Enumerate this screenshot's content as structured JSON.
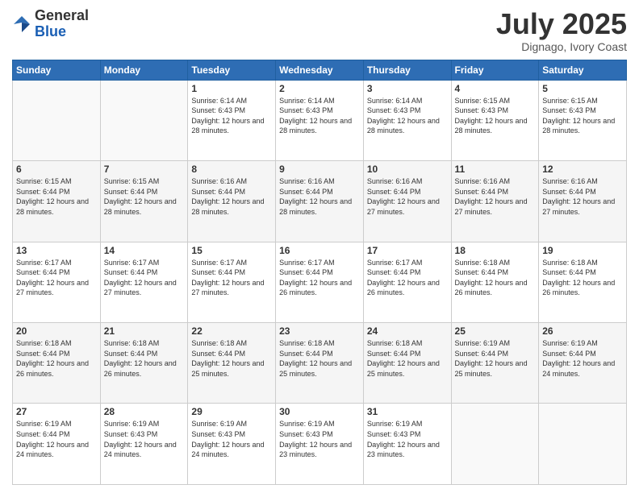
{
  "logo": {
    "general": "General",
    "blue": "Blue"
  },
  "header": {
    "month": "July 2025",
    "location": "Dignago, Ivory Coast"
  },
  "weekdays": [
    "Sunday",
    "Monday",
    "Tuesday",
    "Wednesday",
    "Thursday",
    "Friday",
    "Saturday"
  ],
  "weeks": [
    [
      {
        "day": "",
        "sunrise": "",
        "sunset": "",
        "daylight": ""
      },
      {
        "day": "",
        "sunrise": "",
        "sunset": "",
        "daylight": ""
      },
      {
        "day": "1",
        "sunrise": "Sunrise: 6:14 AM",
        "sunset": "Sunset: 6:43 PM",
        "daylight": "Daylight: 12 hours and 28 minutes."
      },
      {
        "day": "2",
        "sunrise": "Sunrise: 6:14 AM",
        "sunset": "Sunset: 6:43 PM",
        "daylight": "Daylight: 12 hours and 28 minutes."
      },
      {
        "day": "3",
        "sunrise": "Sunrise: 6:14 AM",
        "sunset": "Sunset: 6:43 PM",
        "daylight": "Daylight: 12 hours and 28 minutes."
      },
      {
        "day": "4",
        "sunrise": "Sunrise: 6:15 AM",
        "sunset": "Sunset: 6:43 PM",
        "daylight": "Daylight: 12 hours and 28 minutes."
      },
      {
        "day": "5",
        "sunrise": "Sunrise: 6:15 AM",
        "sunset": "Sunset: 6:43 PM",
        "daylight": "Daylight: 12 hours and 28 minutes."
      }
    ],
    [
      {
        "day": "6",
        "sunrise": "Sunrise: 6:15 AM",
        "sunset": "Sunset: 6:44 PM",
        "daylight": "Daylight: 12 hours and 28 minutes."
      },
      {
        "day": "7",
        "sunrise": "Sunrise: 6:15 AM",
        "sunset": "Sunset: 6:44 PM",
        "daylight": "Daylight: 12 hours and 28 minutes."
      },
      {
        "day": "8",
        "sunrise": "Sunrise: 6:16 AM",
        "sunset": "Sunset: 6:44 PM",
        "daylight": "Daylight: 12 hours and 28 minutes."
      },
      {
        "day": "9",
        "sunrise": "Sunrise: 6:16 AM",
        "sunset": "Sunset: 6:44 PM",
        "daylight": "Daylight: 12 hours and 28 minutes."
      },
      {
        "day": "10",
        "sunrise": "Sunrise: 6:16 AM",
        "sunset": "Sunset: 6:44 PM",
        "daylight": "Daylight: 12 hours and 27 minutes."
      },
      {
        "day": "11",
        "sunrise": "Sunrise: 6:16 AM",
        "sunset": "Sunset: 6:44 PM",
        "daylight": "Daylight: 12 hours and 27 minutes."
      },
      {
        "day": "12",
        "sunrise": "Sunrise: 6:16 AM",
        "sunset": "Sunset: 6:44 PM",
        "daylight": "Daylight: 12 hours and 27 minutes."
      }
    ],
    [
      {
        "day": "13",
        "sunrise": "Sunrise: 6:17 AM",
        "sunset": "Sunset: 6:44 PM",
        "daylight": "Daylight: 12 hours and 27 minutes."
      },
      {
        "day": "14",
        "sunrise": "Sunrise: 6:17 AM",
        "sunset": "Sunset: 6:44 PM",
        "daylight": "Daylight: 12 hours and 27 minutes."
      },
      {
        "day": "15",
        "sunrise": "Sunrise: 6:17 AM",
        "sunset": "Sunset: 6:44 PM",
        "daylight": "Daylight: 12 hours and 27 minutes."
      },
      {
        "day": "16",
        "sunrise": "Sunrise: 6:17 AM",
        "sunset": "Sunset: 6:44 PM",
        "daylight": "Daylight: 12 hours and 26 minutes."
      },
      {
        "day": "17",
        "sunrise": "Sunrise: 6:17 AM",
        "sunset": "Sunset: 6:44 PM",
        "daylight": "Daylight: 12 hours and 26 minutes."
      },
      {
        "day": "18",
        "sunrise": "Sunrise: 6:18 AM",
        "sunset": "Sunset: 6:44 PM",
        "daylight": "Daylight: 12 hours and 26 minutes."
      },
      {
        "day": "19",
        "sunrise": "Sunrise: 6:18 AM",
        "sunset": "Sunset: 6:44 PM",
        "daylight": "Daylight: 12 hours and 26 minutes."
      }
    ],
    [
      {
        "day": "20",
        "sunrise": "Sunrise: 6:18 AM",
        "sunset": "Sunset: 6:44 PM",
        "daylight": "Daylight: 12 hours and 26 minutes."
      },
      {
        "day": "21",
        "sunrise": "Sunrise: 6:18 AM",
        "sunset": "Sunset: 6:44 PM",
        "daylight": "Daylight: 12 hours and 26 minutes."
      },
      {
        "day": "22",
        "sunrise": "Sunrise: 6:18 AM",
        "sunset": "Sunset: 6:44 PM",
        "daylight": "Daylight: 12 hours and 25 minutes."
      },
      {
        "day": "23",
        "sunrise": "Sunrise: 6:18 AM",
        "sunset": "Sunset: 6:44 PM",
        "daylight": "Daylight: 12 hours and 25 minutes."
      },
      {
        "day": "24",
        "sunrise": "Sunrise: 6:18 AM",
        "sunset": "Sunset: 6:44 PM",
        "daylight": "Daylight: 12 hours and 25 minutes."
      },
      {
        "day": "25",
        "sunrise": "Sunrise: 6:19 AM",
        "sunset": "Sunset: 6:44 PM",
        "daylight": "Daylight: 12 hours and 25 minutes."
      },
      {
        "day": "26",
        "sunrise": "Sunrise: 6:19 AM",
        "sunset": "Sunset: 6:44 PM",
        "daylight": "Daylight: 12 hours and 24 minutes."
      }
    ],
    [
      {
        "day": "27",
        "sunrise": "Sunrise: 6:19 AM",
        "sunset": "Sunset: 6:44 PM",
        "daylight": "Daylight: 12 hours and 24 minutes."
      },
      {
        "day": "28",
        "sunrise": "Sunrise: 6:19 AM",
        "sunset": "Sunset: 6:43 PM",
        "daylight": "Daylight: 12 hours and 24 minutes."
      },
      {
        "day": "29",
        "sunrise": "Sunrise: 6:19 AM",
        "sunset": "Sunset: 6:43 PM",
        "daylight": "Daylight: 12 hours and 24 minutes."
      },
      {
        "day": "30",
        "sunrise": "Sunrise: 6:19 AM",
        "sunset": "Sunset: 6:43 PM",
        "daylight": "Daylight: 12 hours and 23 minutes."
      },
      {
        "day": "31",
        "sunrise": "Sunrise: 6:19 AM",
        "sunset": "Sunset: 6:43 PM",
        "daylight": "Daylight: 12 hours and 23 minutes."
      },
      {
        "day": "",
        "sunrise": "",
        "sunset": "",
        "daylight": ""
      },
      {
        "day": "",
        "sunrise": "",
        "sunset": "",
        "daylight": ""
      }
    ]
  ]
}
